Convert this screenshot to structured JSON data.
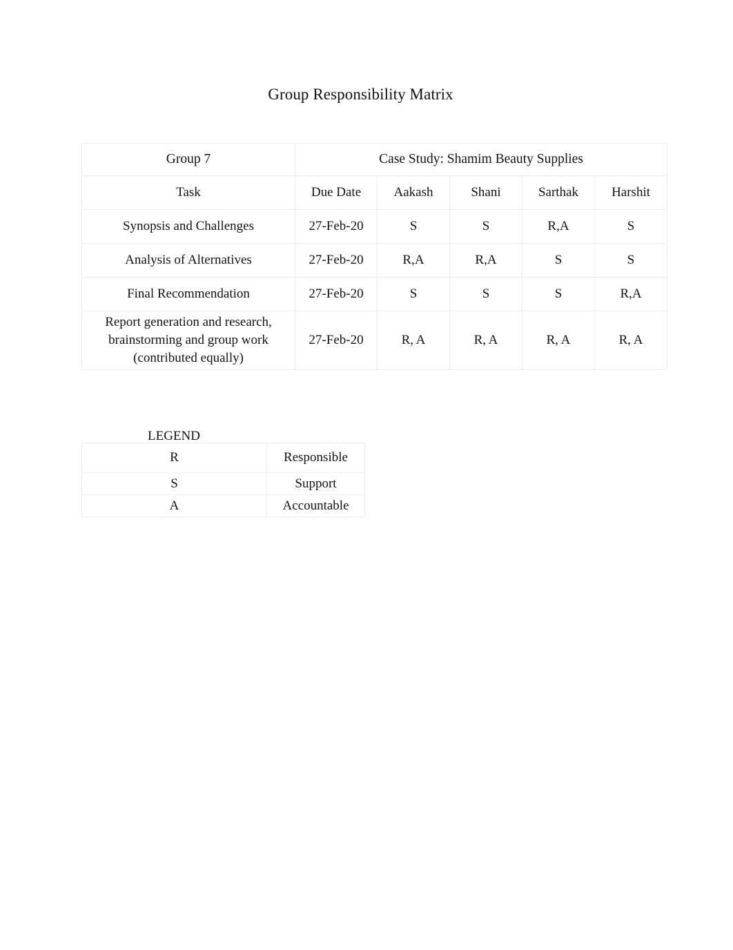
{
  "document": {
    "title": "Group Responsibility Matrix"
  },
  "matrix": {
    "group_label": "Group 7",
    "case_study_label": "Case Study: Shamim Beauty Supplies",
    "columns": [
      "Task",
      "Due Date",
      "Aakash",
      "Shani",
      "Sarthak",
      "Harshit"
    ],
    "rows": [
      {
        "task": "Synopsis and Challenges",
        "task_lines": [
          "Synopsis and Challenges"
        ],
        "due_date": "27-Feb-20",
        "aakash": "S",
        "shani": "S",
        "sarthak": "R,A",
        "harshit": "S"
      },
      {
        "task": "Analysis of Alternatives",
        "task_lines": [
          "Analysis of Alternatives"
        ],
        "due_date": "27-Feb-20",
        "aakash": "R,A",
        "shani": "R,A",
        "sarthak": "S",
        "harshit": "S"
      },
      {
        "task": "Final Recommendation",
        "task_lines": [
          "Final Recommendation"
        ],
        "due_date": "27-Feb-20",
        "aakash": "S",
        "shani": "S",
        "sarthak": "S",
        "harshit": "R,A"
      },
      {
        "task": "Report generation and research, brainstorming and group work (contributed equally)",
        "task_lines": [
          "Report generation and research,",
          "brainstorming and group work",
          "(contributed equally)"
        ],
        "due_date": "27-Feb-20",
        "aakash": "R, A",
        "shani": "R, A",
        "sarthak": "R, A",
        "harshit": "R, A"
      }
    ]
  },
  "legend": {
    "label": "LEGEND",
    "entries": [
      {
        "code": "R",
        "meaning": "Responsible"
      },
      {
        "code": "S",
        "meaning": "Support"
      },
      {
        "code": "A",
        "meaning": "Accountable"
      }
    ]
  }
}
